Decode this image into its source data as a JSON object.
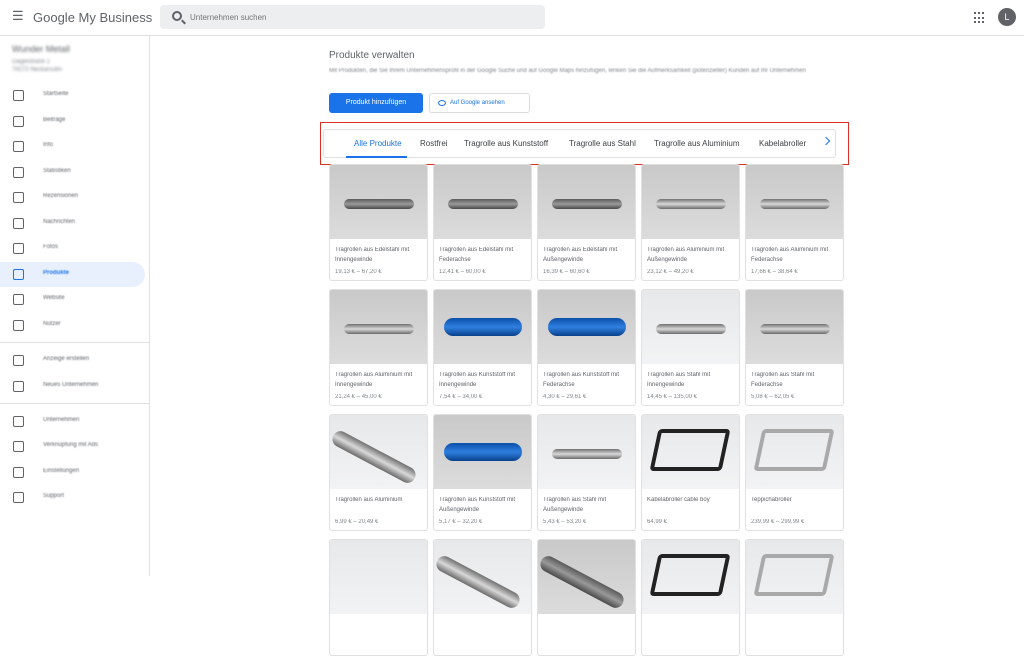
{
  "header": {
    "menu_icon": "menu-icon",
    "logo_google": "Google",
    "logo_product": "My Business",
    "search_placeholder": "Unternehmen suchen",
    "avatar_initial": "L"
  },
  "sidebar": {
    "business_name": "Wunder Metall",
    "business_address_1": "Gagelstraße 1",
    "business_address_2": "74172 Neckarsulm",
    "items": [
      {
        "label": "Startseite",
        "icon": "home-icon"
      },
      {
        "label": "Beiträge",
        "icon": "posts-icon"
      },
      {
        "label": "Info",
        "icon": "info-icon"
      },
      {
        "label": "Statistiken",
        "icon": "stats-icon"
      },
      {
        "label": "Rezensionen",
        "icon": "reviews-icon"
      },
      {
        "label": "Nachrichten",
        "icon": "messages-icon"
      },
      {
        "label": "Fotos",
        "icon": "photos-icon"
      },
      {
        "label": "Produkte",
        "icon": "products-icon"
      },
      {
        "label": "Website",
        "icon": "website-icon"
      },
      {
        "label": "Nutzer",
        "icon": "users-icon"
      },
      {
        "label": "Anzeige erstellen",
        "icon": "ads-icon"
      },
      {
        "label": "Neues Unternehmen",
        "icon": "location-icon"
      },
      {
        "label": "Unternehmen",
        "icon": "businesses-icon"
      },
      {
        "label": "Verknüpfung mit Ads",
        "icon": "link-icon"
      },
      {
        "label": "Einstellungen",
        "icon": "settings-icon"
      },
      {
        "label": "Support",
        "icon": "help-icon"
      }
    ]
  },
  "main": {
    "title": "Produkte verwalten",
    "description": "Mit Produkten, die Sie Ihrem Unternehmensprofil in der Google Suche und auf Google Maps hinzufügen, lenken Sie die Aufmerksamkeit (potenzieller) Kunden auf Ihr Unternehmen",
    "add_button": "Produkt hinzufügen",
    "view_button": "Auf Google ansehen",
    "tabs": [
      "Alle Produkte",
      "Rostfrei",
      "Tragrolle aus Kunststoff",
      "Tragrolle aus Stahl",
      "Tragrolle aus Aluminium",
      "Kabelabroller"
    ],
    "products": [
      {
        "name": "Tragrollen aus Edelstahl mit Innengewinde",
        "price": "19,13 € – 67,20 €"
      },
      {
        "name": "Tragrollen aus Edelstahl mit Federachse",
        "price": "12,41 € – 60,00 €"
      },
      {
        "name": "Tragrollen aus Edelstahl mit Außengewinde",
        "price": "16,39 € – 60,60 €"
      },
      {
        "name": "Tragrollen aus Aluminium mit Außengewinde",
        "price": "23,12 € – 49,20 €"
      },
      {
        "name": "Tragrollen aus Aluminium mit Federachse",
        "price": "17,66 € – 38,64 €"
      },
      {
        "name": "Tragrollen aus Aluminium mit Innengewinde",
        "price": "21,24 € – 45,00 €"
      },
      {
        "name": "Tragrollen aus Kunststoff mit Innengewinde",
        "price": "7,54 € – 34,00 €"
      },
      {
        "name": "Tragrollen aus Kunststoff mit Federachse",
        "price": "4,30 € – 29,61 €"
      },
      {
        "name": "Tragrollen aus Stahl mit Innengewinde",
        "price": "14,45 € – 135,00 €"
      },
      {
        "name": "Tragrollen aus Stahl mit Federachse",
        "price": "5,08 € – 62,05 €"
      },
      {
        "name": "Tragrollen aus Aluminium",
        "price": "6,99 € – 20,49 €"
      },
      {
        "name": "Tragrollen aus Kunststoff mit Außengewinde",
        "price": "5,17 € – 32,20 €"
      },
      {
        "name": "Tragrollen aus Stahl mit Außengewinde",
        "price": "5,43 € – 53,20 €"
      },
      {
        "name": "Kabelabroller cable boy",
        "price": "64,99 €"
      },
      {
        "name": "Teppichabroller",
        "price": "239,99 € – 299,99 €"
      }
    ]
  },
  "colors": {
    "accent": "#1a73e8",
    "highlight_border": "#d93025"
  }
}
